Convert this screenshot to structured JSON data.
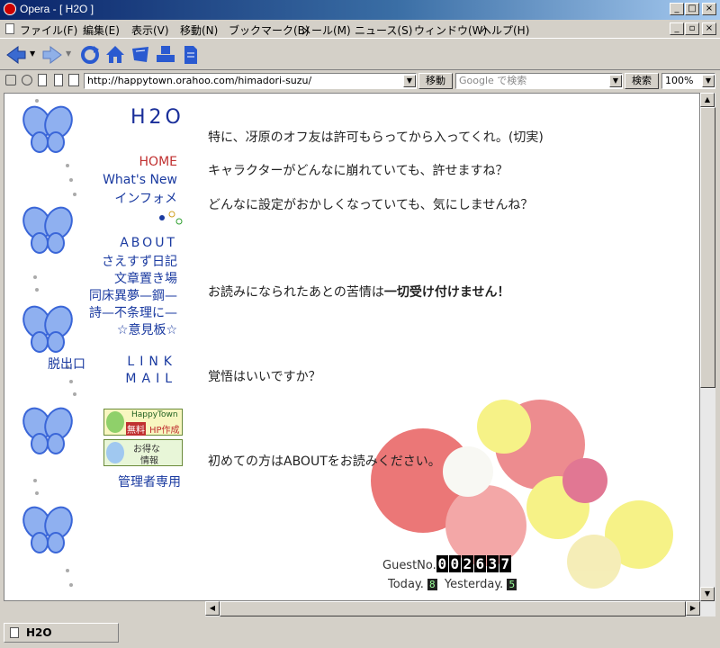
{
  "window": {
    "title": "Opera - [ H2O ]",
    "controls": [
      "_",
      "□",
      "×"
    ],
    "doc_controls": [
      "_",
      "▫",
      "×"
    ]
  },
  "menu": [
    "ファイル(F)",
    "編集(E)",
    "表示(V)",
    "移動(N)",
    "ブックマーク(B)",
    "メール(M)",
    "ニュース(S)",
    "ウィンドウ(W)",
    "ヘルプ(H)"
  ],
  "address": {
    "url": "http://happytown.orahoo.com/himadori-suzu/",
    "go_label": "移動",
    "search_placeholder": "Google で検索",
    "search_label": "検索",
    "zoom": "100%"
  },
  "site": {
    "title": "H2O",
    "nav": {
      "home": "HOME",
      "whats_new": "What's New",
      "info": "インフォメ",
      "about": "ABOUT",
      "diary": "さえすず日記",
      "writings": "文章置き場",
      "doujin": "同床異夢—鋼—",
      "poems": "詩—不条理に—",
      "bbs": "☆意見板☆",
      "exit": "脱出口",
      "link": "LINK",
      "mail": "MAIL",
      "admin": "管理者専用"
    },
    "banners": {
      "happytown_line1": "HappyTown",
      "happytown_free": "無料",
      "happytown_line2": "HP作成",
      "deals_line1": "お得な",
      "deals_line2": "情報"
    },
    "colors": {
      "home": "#c03030",
      "nav": "#1a3aa0",
      "title": "#1a2f9a"
    }
  },
  "content": {
    "line1": "特に、冴原のオフ友は許可もらってから入ってくれ。(切実)",
    "line2": "キャラクターがどんなに崩れていても、許せますね？",
    "line3": "どんなに設定がおかしくなっていても、気にしませんね？",
    "line4_prefix": "お読みになられたあとの苦情は",
    "line4_bold": "一切受け付けません！",
    "line5": "覚悟はいいですか？",
    "line6": "初めての方はABOUTをお読みください。"
  },
  "counter": {
    "label": "GuestNo.",
    "digits": [
      "0",
      "0",
      "2",
      "6",
      "3",
      "7"
    ],
    "today_label": "Today.",
    "today": "8",
    "yesterday_label": "Yesterday.",
    "yesterday": "5"
  },
  "status": {
    "tab_title": "H2O"
  }
}
